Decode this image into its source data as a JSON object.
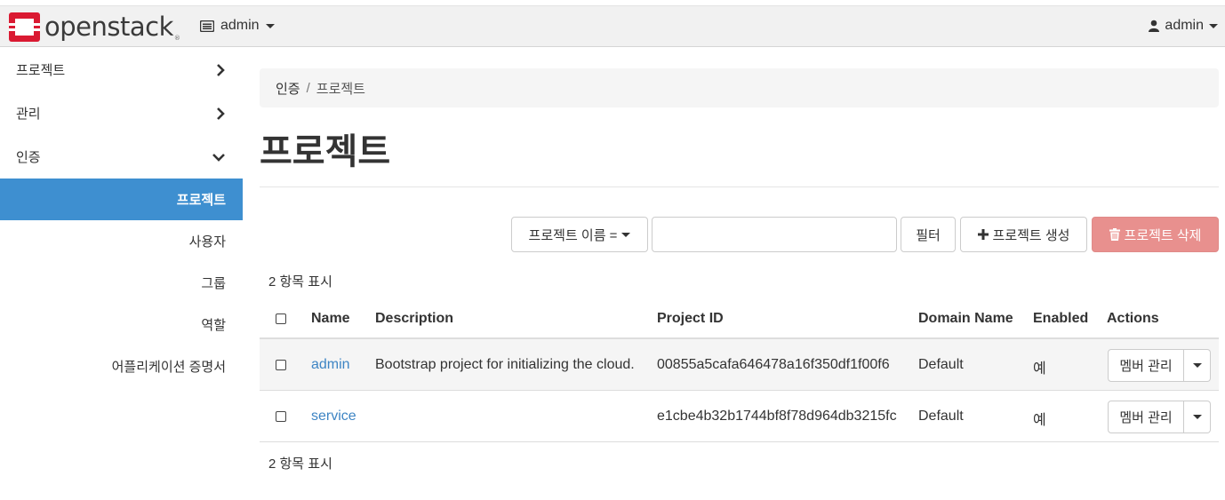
{
  "brand": {
    "name": "openstack",
    "mark": "®"
  },
  "navbar": {
    "project": "admin",
    "user": "admin"
  },
  "sidebar": {
    "groups": [
      {
        "label": "프로젝트",
        "state": "collapsed"
      },
      {
        "label": "관리",
        "state": "collapsed"
      },
      {
        "label": "인증",
        "state": "expanded"
      }
    ],
    "items": [
      {
        "label": "프로젝트",
        "active": true
      },
      {
        "label": "사용자",
        "active": false
      },
      {
        "label": "그룹",
        "active": false
      },
      {
        "label": "역할",
        "active": false
      },
      {
        "label": "어플리케이션 증명서",
        "active": false
      }
    ]
  },
  "breadcrumb": {
    "parent": "인증",
    "separator": "/",
    "current": "프로젝트"
  },
  "page": {
    "title": "프로젝트"
  },
  "toolbar": {
    "filter_select": "프로젝트 이름 =",
    "filter_value": "",
    "filter_button": "필터",
    "create_button": "프로젝트 생성",
    "delete_button": "프로젝트 삭제"
  },
  "count_top": "2 항목 표시",
  "count_bottom": "2 항목 표시",
  "table": {
    "headers": {
      "name": "Name",
      "description": "Description",
      "project_id": "Project ID",
      "domain": "Domain Name",
      "enabled": "Enabled",
      "actions": "Actions"
    },
    "rows": [
      {
        "name": "admin",
        "description": "Bootstrap project for initializing the cloud.",
        "project_id": "00855a5cafa646478a16f350df1f00f6",
        "domain": "Default",
        "enabled": "예",
        "action": "멤버 관리"
      },
      {
        "name": "service",
        "description": "",
        "project_id": "e1cbe4b32b1744bf8f78d964db3215fc",
        "domain": "Default",
        "enabled": "예",
        "action": "멤버 관리"
      }
    ]
  },
  "colors": {
    "accent": "#3e8fd0",
    "link": "#3e85c4",
    "danger": "#e8908e",
    "brand_red": "#da1a32"
  }
}
